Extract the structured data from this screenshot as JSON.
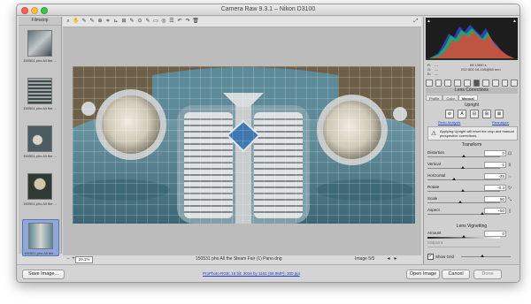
{
  "window": {
    "title": "Camera Raw 9.3.1  –  Nikon D3100"
  },
  "filmstrip": {
    "header": "Filmstrip",
    "items": [
      {
        "caption": "150501 pho All the ..."
      },
      {
        "caption": "150501 pho All the ..."
      },
      {
        "caption": "150501 pho All the ..."
      },
      {
        "caption": "150501 pho All the ..."
      },
      {
        "caption": "150501 pho All the ..."
      }
    ]
  },
  "toolbar": {
    "tools": [
      {
        "icon": "zoom-icon",
        "glyph": "⌕"
      },
      {
        "icon": "hand-icon",
        "glyph": "✋"
      },
      {
        "icon": "white-balance-icon",
        "glyph": "✎"
      },
      {
        "icon": "color-sampler-icon",
        "glyph": "✎"
      },
      {
        "icon": "target-adjust-icon",
        "glyph": "⊕"
      },
      {
        "icon": "crop-icon",
        "glyph": "⌗"
      },
      {
        "icon": "straighten-icon",
        "glyph": "⊾"
      },
      {
        "icon": "transform-icon",
        "glyph": "⊞"
      },
      {
        "icon": "spot-removal-icon",
        "glyph": "✎"
      },
      {
        "icon": "red-eye-icon",
        "glyph": "⊙"
      },
      {
        "icon": "adjustment-brush-icon",
        "glyph": "✎"
      },
      {
        "icon": "graduated-filter-icon",
        "glyph": "▭"
      },
      {
        "icon": "radial-filter-icon",
        "glyph": "◎"
      },
      {
        "icon": "preferences-icon",
        "glyph": "☰"
      },
      {
        "icon": "rotate-ccw-icon",
        "glyph": "↶"
      },
      {
        "icon": "rotate-cw-icon",
        "glyph": "↷"
      },
      {
        "icon": "trash-icon",
        "glyph": "🗑"
      }
    ]
  },
  "statusbar": {
    "zoom": "29.1%",
    "filename": "150531 pho All the Steam Fair (1) Pano.dng",
    "image_count": "Image 5/5"
  },
  "footer": {
    "save_label": "Save Image...",
    "workflow_link": "ProPhoto RGB; 16 bit; 3016 by 1161 (68.9MP); 300 ppi",
    "open_label": "Open Image",
    "cancel_label": "Cancel",
    "done_label": "Done"
  },
  "panel": {
    "readout": {
      "r": "R:",
      "g": "G:",
      "b": "B:",
      "r_val": "---",
      "g_val": "---",
      "b_val": "---",
      "aperture": "f/8   1/500 s",
      "iso": "ISO 800   18-105@58 mm"
    },
    "section_title": "Lens Corrections",
    "subtabs": [
      "Profile",
      "Color",
      "Manual"
    ],
    "upright_title": "Upright",
    "upright_buttons": [
      "⊘",
      "A",
      "⊟",
      "⊞",
      "⊠"
    ],
    "upright_links": [
      "Redo Analysis",
      "Reanalyze"
    ],
    "upright_note": "Applying Upright will reset the crop and manual perspective corrections.",
    "transform_title": "Transform",
    "sliders": [
      {
        "label": "Distortion",
        "value": "0",
        "pos": 0.5,
        "icon": "distortion-icon"
      },
      {
        "label": "Vertical",
        "value": "-1",
        "pos": 0.49,
        "icon": "vertical-icon"
      },
      {
        "label": "Horizontal",
        "value": "-25",
        "pos": 0.37,
        "icon": "horizontal-icon"
      },
      {
        "label": "Rotate",
        "value": "-0.3",
        "pos": 0.49,
        "icon": "rotate-icon"
      },
      {
        "label": "Scale",
        "value": "90",
        "pos": 0.45,
        "icon": "scale-icon"
      },
      {
        "label": "Aspect",
        "value": "+50",
        "pos": 0.75,
        "icon": "aspect-icon"
      }
    ],
    "vignetting_title": "Lens Vignetting",
    "amount": {
      "label": "Amount",
      "value": "0",
      "pos": 0.5
    },
    "midpoint": {
      "label": "Midpoint"
    },
    "show_grid_label": "Show Grid"
  },
  "colors": {
    "car_body": "#4f7f8f",
    "grille": "#cfd3d4",
    "background_stone": "#7a6b50"
  }
}
